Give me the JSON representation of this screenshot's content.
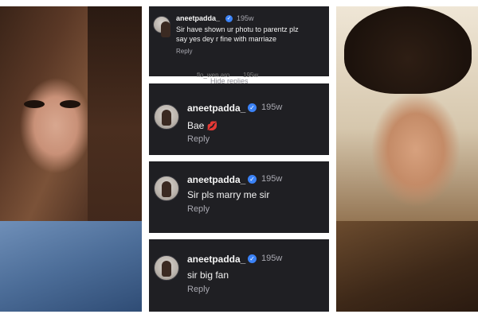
{
  "comments": [
    {
      "username": "aneetpadda_",
      "time": "195w",
      "text_line1": "Sir have shown ur photu to parentz plz",
      "text_line2": "say yes dey r fine with marriaze",
      "reply": "Reply",
      "sub_username": "flo_wen.aro",
      "sub_time": "195w",
      "hide_replies": "Hide replies"
    },
    {
      "username": "aneetpadda_",
      "time": "195w",
      "text": "Bae",
      "emoji": "💋",
      "reply": "Reply"
    },
    {
      "username": "aneetpadda_",
      "time": "195w",
      "text": "Sir pls marry me sir",
      "reply": "Reply"
    },
    {
      "username": "aneetpadda_",
      "time": "195w",
      "text": "sir big fan",
      "reply": "Reply"
    }
  ],
  "icons": {
    "verified": "verified-badge-icon",
    "avatar": "avatar"
  },
  "colors": {
    "card_bg": "#1f1f23",
    "verified": "#3b82f6",
    "muted": "#a8a8b0"
  }
}
